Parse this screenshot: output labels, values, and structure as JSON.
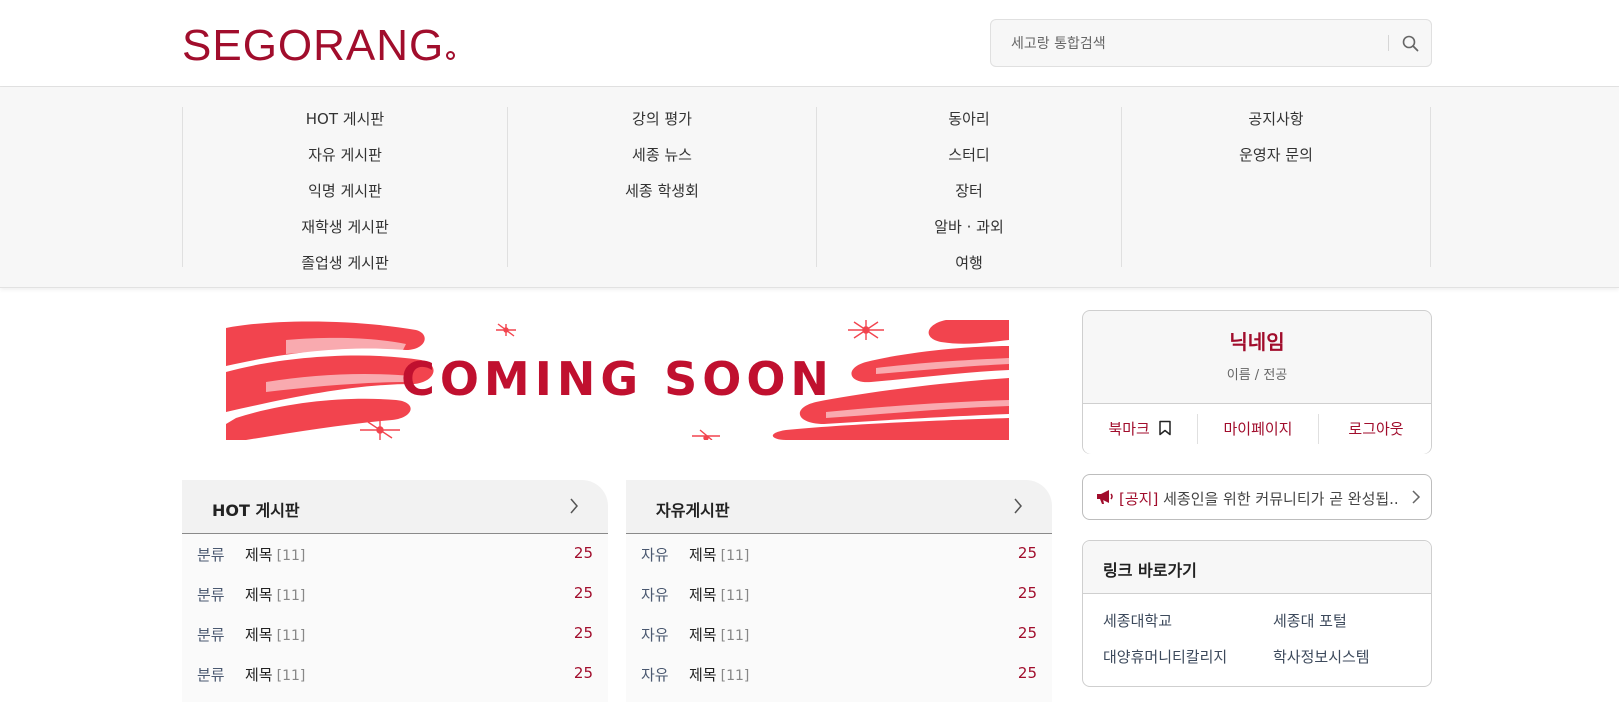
{
  "header": {
    "logo_text": "SEGORANG",
    "search_placeholder": "세고랑 통합검색",
    "search_icon": "search-icon"
  },
  "nav": {
    "columns": [
      {
        "items": [
          "HOT 게시판",
          "자유 게시판",
          "익명 게시판",
          "재학생 게시판",
          "졸업생 게시판"
        ]
      },
      {
        "items": [
          "강의 평가",
          "세종 뉴스",
          "세종 학생회"
        ]
      },
      {
        "items": [
          "동아리",
          "스터디",
          "장터",
          "알바 · 과외",
          "여행"
        ]
      },
      {
        "items": [
          "공지사항",
          "운영자 문의"
        ]
      }
    ]
  },
  "banner": {
    "text": "COMING SOON"
  },
  "profile": {
    "nickname": "닉네임",
    "subtitle": "이름 / 전공",
    "bookmark_label": "북마크",
    "bookmark_icon": "bookmark-icon",
    "mypage_label": "마이페이지",
    "logout_label": "로그아웃"
  },
  "notice": {
    "icon": "megaphone-icon",
    "tag": "[공지]",
    "text": "세종인을 위한 커뮤니티가 곧 완성됩..."
  },
  "links": {
    "title": "링크 바로가기",
    "items": [
      "세종대학교",
      "세종대 포털",
      "대양휴머니티칼리지",
      "학사정보시스템"
    ]
  },
  "boards": [
    {
      "title": "HOT 게시판",
      "rows": [
        {
          "category": "분류",
          "title": "제목",
          "count": "[11]",
          "number": "25"
        },
        {
          "category": "분류",
          "title": "제목",
          "count": "[11]",
          "number": "25"
        },
        {
          "category": "분류",
          "title": "제목",
          "count": "[11]",
          "number": "25"
        },
        {
          "category": "분류",
          "title": "제목",
          "count": "[11]",
          "number": "25"
        }
      ]
    },
    {
      "title": "자유게시판",
      "rows": [
        {
          "category": "자유",
          "title": "제목",
          "count": "[11]",
          "number": "25"
        },
        {
          "category": "자유",
          "title": "제목",
          "count": "[11]",
          "number": "25"
        },
        {
          "category": "자유",
          "title": "제목",
          "count": "[11]",
          "number": "25"
        },
        {
          "category": "자유",
          "title": "제목",
          "count": "[11]",
          "number": "25"
        }
      ]
    }
  ],
  "colors": {
    "accent": "#a10d2c",
    "banner_red": "#f2444e",
    "banner_text": "#c0102f"
  }
}
